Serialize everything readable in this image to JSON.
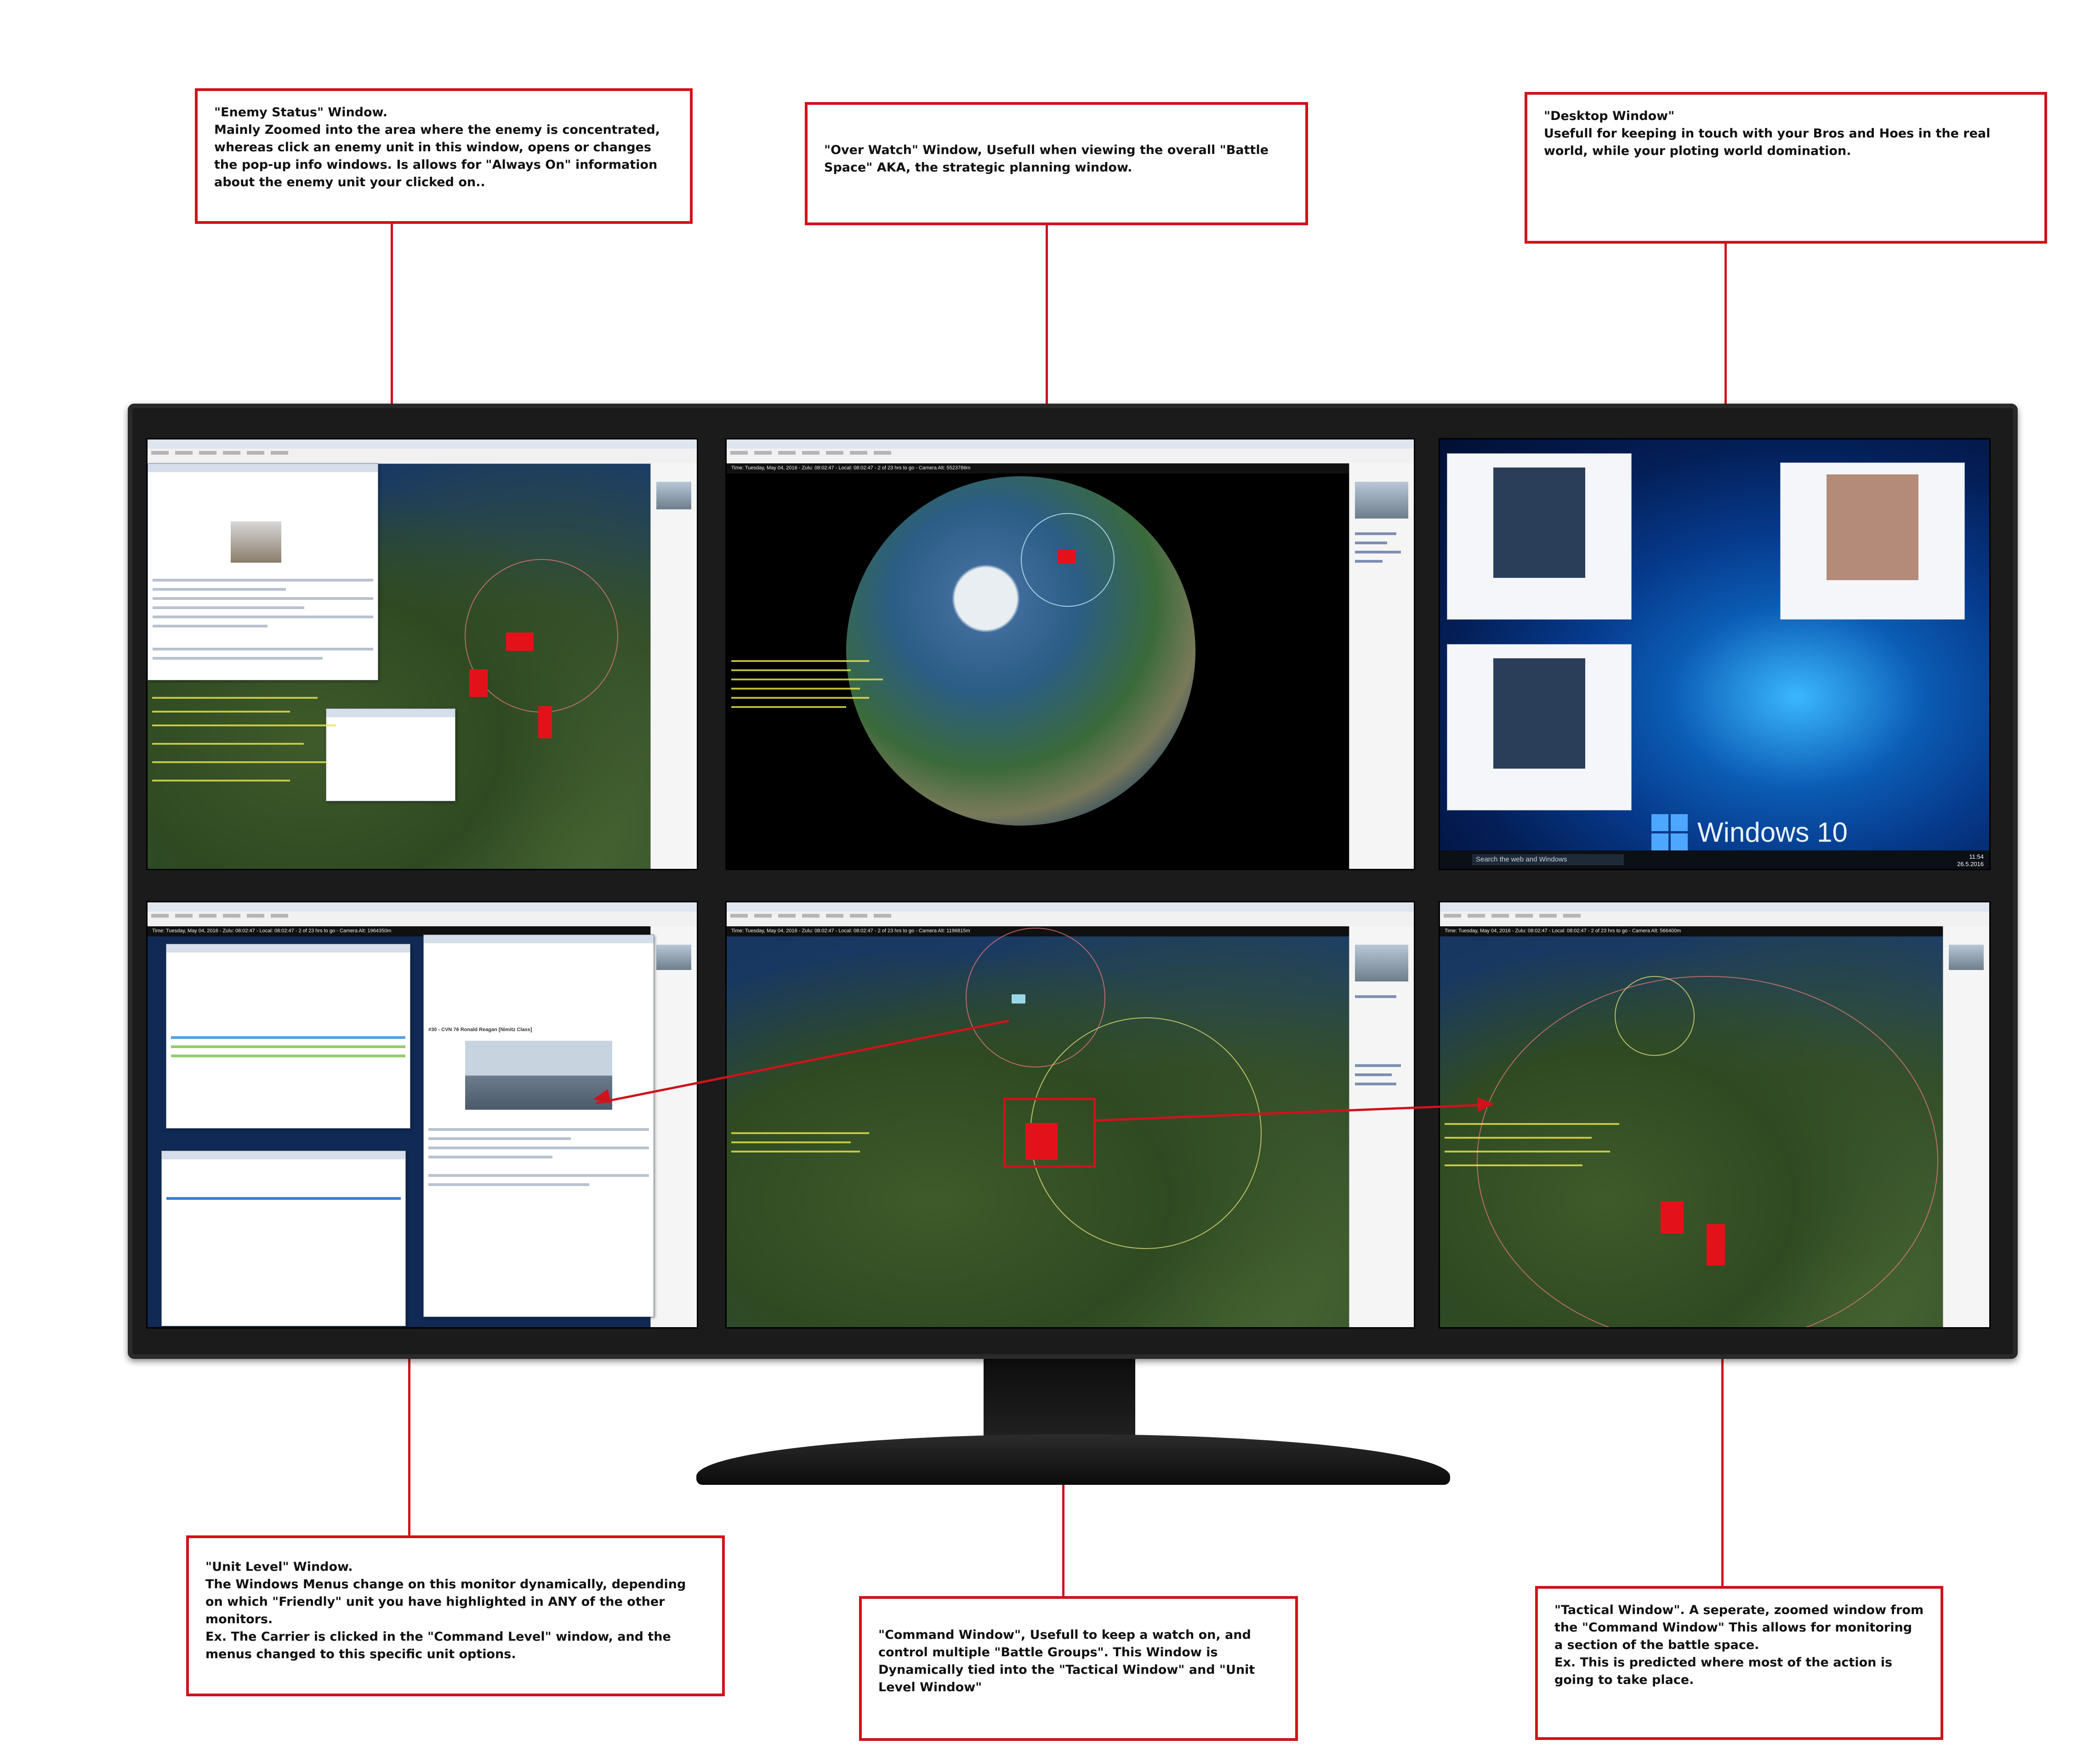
{
  "callouts": {
    "enemy_status": {
      "title": "\"Enemy Status\" Window.",
      "body": "Mainly Zoomed into the area where the enemy is concentrated, whereas click an enemy unit in this window, opens or changes the pop-up info windows. Is allows for \"Always On\" information about the enemy unit your clicked on.."
    },
    "over_watch": {
      "body": "\"Over Watch\" Window, Usefull when viewing the overall \"Battle Space\" AKA, the strategic planning window."
    },
    "desktop": {
      "title": "\"Desktop Window\"",
      "body": "Usefull for keeping in touch with your Bros and Hoes in the real world, while your ploting world domination."
    },
    "unit_level": {
      "title": "\"Unit Level\" Window.",
      "body": "The Windows Menus change on this monitor dynamically, depending on which \"Friendly\" unit you have highlighted in ANY of the other monitors.\nEx. The Carrier is clicked in the \"Command Level\" window, and the menus changed to this specific unit options."
    },
    "command": {
      "body": "\"Command Window\", Usefull to keep a watch on, and control multiple \"Battle Groups\". This Window is Dynamically tied into the \"Tactical Window\" and \"Unit Level Window\""
    },
    "tactical": {
      "title": "\"Tactical Window\". A seperate, zoomed window from the \"Command Window\" This allows for monitoring a section of the battle space.",
      "body": "Ex. This is predicted where most of the action is going to take place."
    }
  },
  "screens": {
    "overwatch_status": "Time: Tuesday, May 04, 2016 - Zulu: 08:02:47 - Local: 08:02:47 - 2 of 23 hrs to go - Camera Alt: 5523786m",
    "command_status": "Time: Tuesday, May 04, 2016 - Zulu: 08:02:47 - Local: 08:02:47 - 2 of 23 hrs to go - Camera Alt: 1196815m",
    "tactical_status": "Time: Tuesday, May 04, 2016 - Zulu: 08:02:47 - Local: 08:02:47 - 2 of 23 hrs to go - Camera Alt: 566400m",
    "unit_status": "Time: Tuesday, May 04, 2016 - Zulu: 08:02:47 - Local: 08:02:47 - 2 of 23 hrs to go - Camera Alt: 1964350m",
    "unit_popup_title": "#30 - CVN 76 Ronald Reagan [Nimitz Class]",
    "desktop_search": "Search the web and Windows",
    "windows_label": "Windows 10",
    "clock_time": "11:54",
    "clock_date": "26.5.2016"
  },
  "colors": {
    "callout_border": "#d0121b",
    "enemy_marker": "#e3121a",
    "log_text": "#e8e64a"
  }
}
